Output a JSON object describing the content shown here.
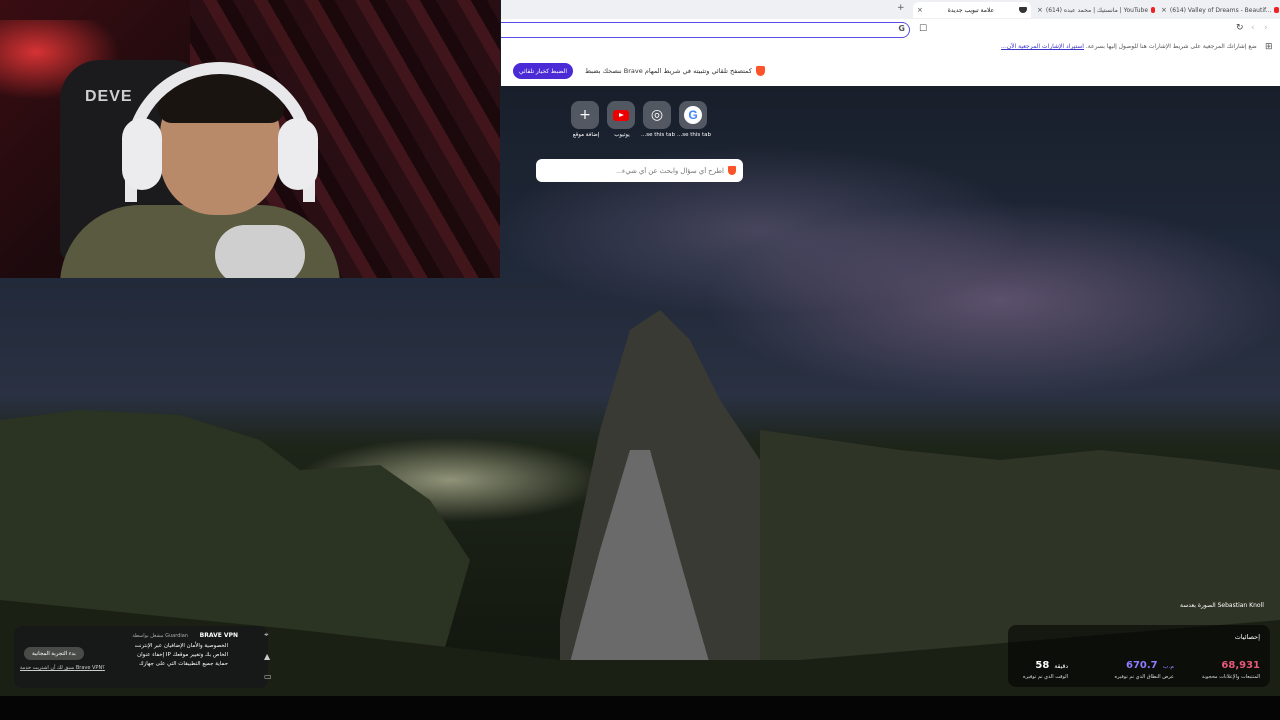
{
  "tabs": [
    {
      "label": "(614) Valley of Dreams - Beautif...",
      "icon": "youtube-icon"
    },
    {
      "label": "(614) مانستيك | محمد عبده | YouTube",
      "icon": "youtube-icon"
    },
    {
      "label": "علامة تبويب جديدة",
      "icon": "brave-shield-icon",
      "active": true
    }
  ],
  "bookmarks_hint": {
    "text": "ضع إشاراتك المرجعية على شريط الإشارات هنا للوصول إليها بسرعة.",
    "link": "استيراد الإشارات المرجعية الآن..."
  },
  "banner": {
    "text": "ننصحك بضبط Brave كمتصفح تلقائي وتثبيته في شريط المهام",
    "button": "الضبط كخيار تلقائي"
  },
  "top_sites": [
    {
      "label": "إضافة موقع",
      "icon": "plus-icon"
    },
    {
      "label": "يوتيوب",
      "icon": "youtube-icon"
    },
    {
      "label": "...se this tab",
      "icon": "globe-icon"
    },
    {
      "label": "...se this tab",
      "icon": "google-icon"
    }
  ],
  "search": {
    "placeholder": "اطرح أي سؤال وابحث عن أي شيء..."
  },
  "photo_credit": "الصورة بعدسة Sebastian Knoll",
  "stats": {
    "title": "إحصائيات",
    "items": [
      {
        "value": "68,931",
        "unit": "",
        "desc": "المتتبعات والإعلانات محجوبة",
        "color": "#e8597a"
      },
      {
        "value": "670.7",
        "unit": "م.ب",
        "desc": "عرض النطاق الذي تم توفيره",
        "color": "#8f7cff"
      },
      {
        "value": "58",
        "unit": "دقيقة",
        "desc": "الوقت الذي تم توفيره",
        "color": "#ffffff"
      }
    ]
  },
  "vpn": {
    "brand": "BRAVE VPN",
    "powered": "مشغل بواسطة Guardian",
    "features": [
      "الخصوصية والأمان الإضافيان عبر الإنترنت",
      "إخفاء عنوان IP الخاص بك وتغيير موقعك",
      "حماية جميع التطبيقات التي على جهازك"
    ],
    "trial_button": "بدء التجربة المجانية",
    "already_link": "سبق لك أن اشتريت خدمة Brave VPN؟"
  },
  "webcam": {
    "chair_label": "DEVE"
  },
  "colors": {
    "accent": "#4b2bd6",
    "brave": "#fb542b"
  }
}
